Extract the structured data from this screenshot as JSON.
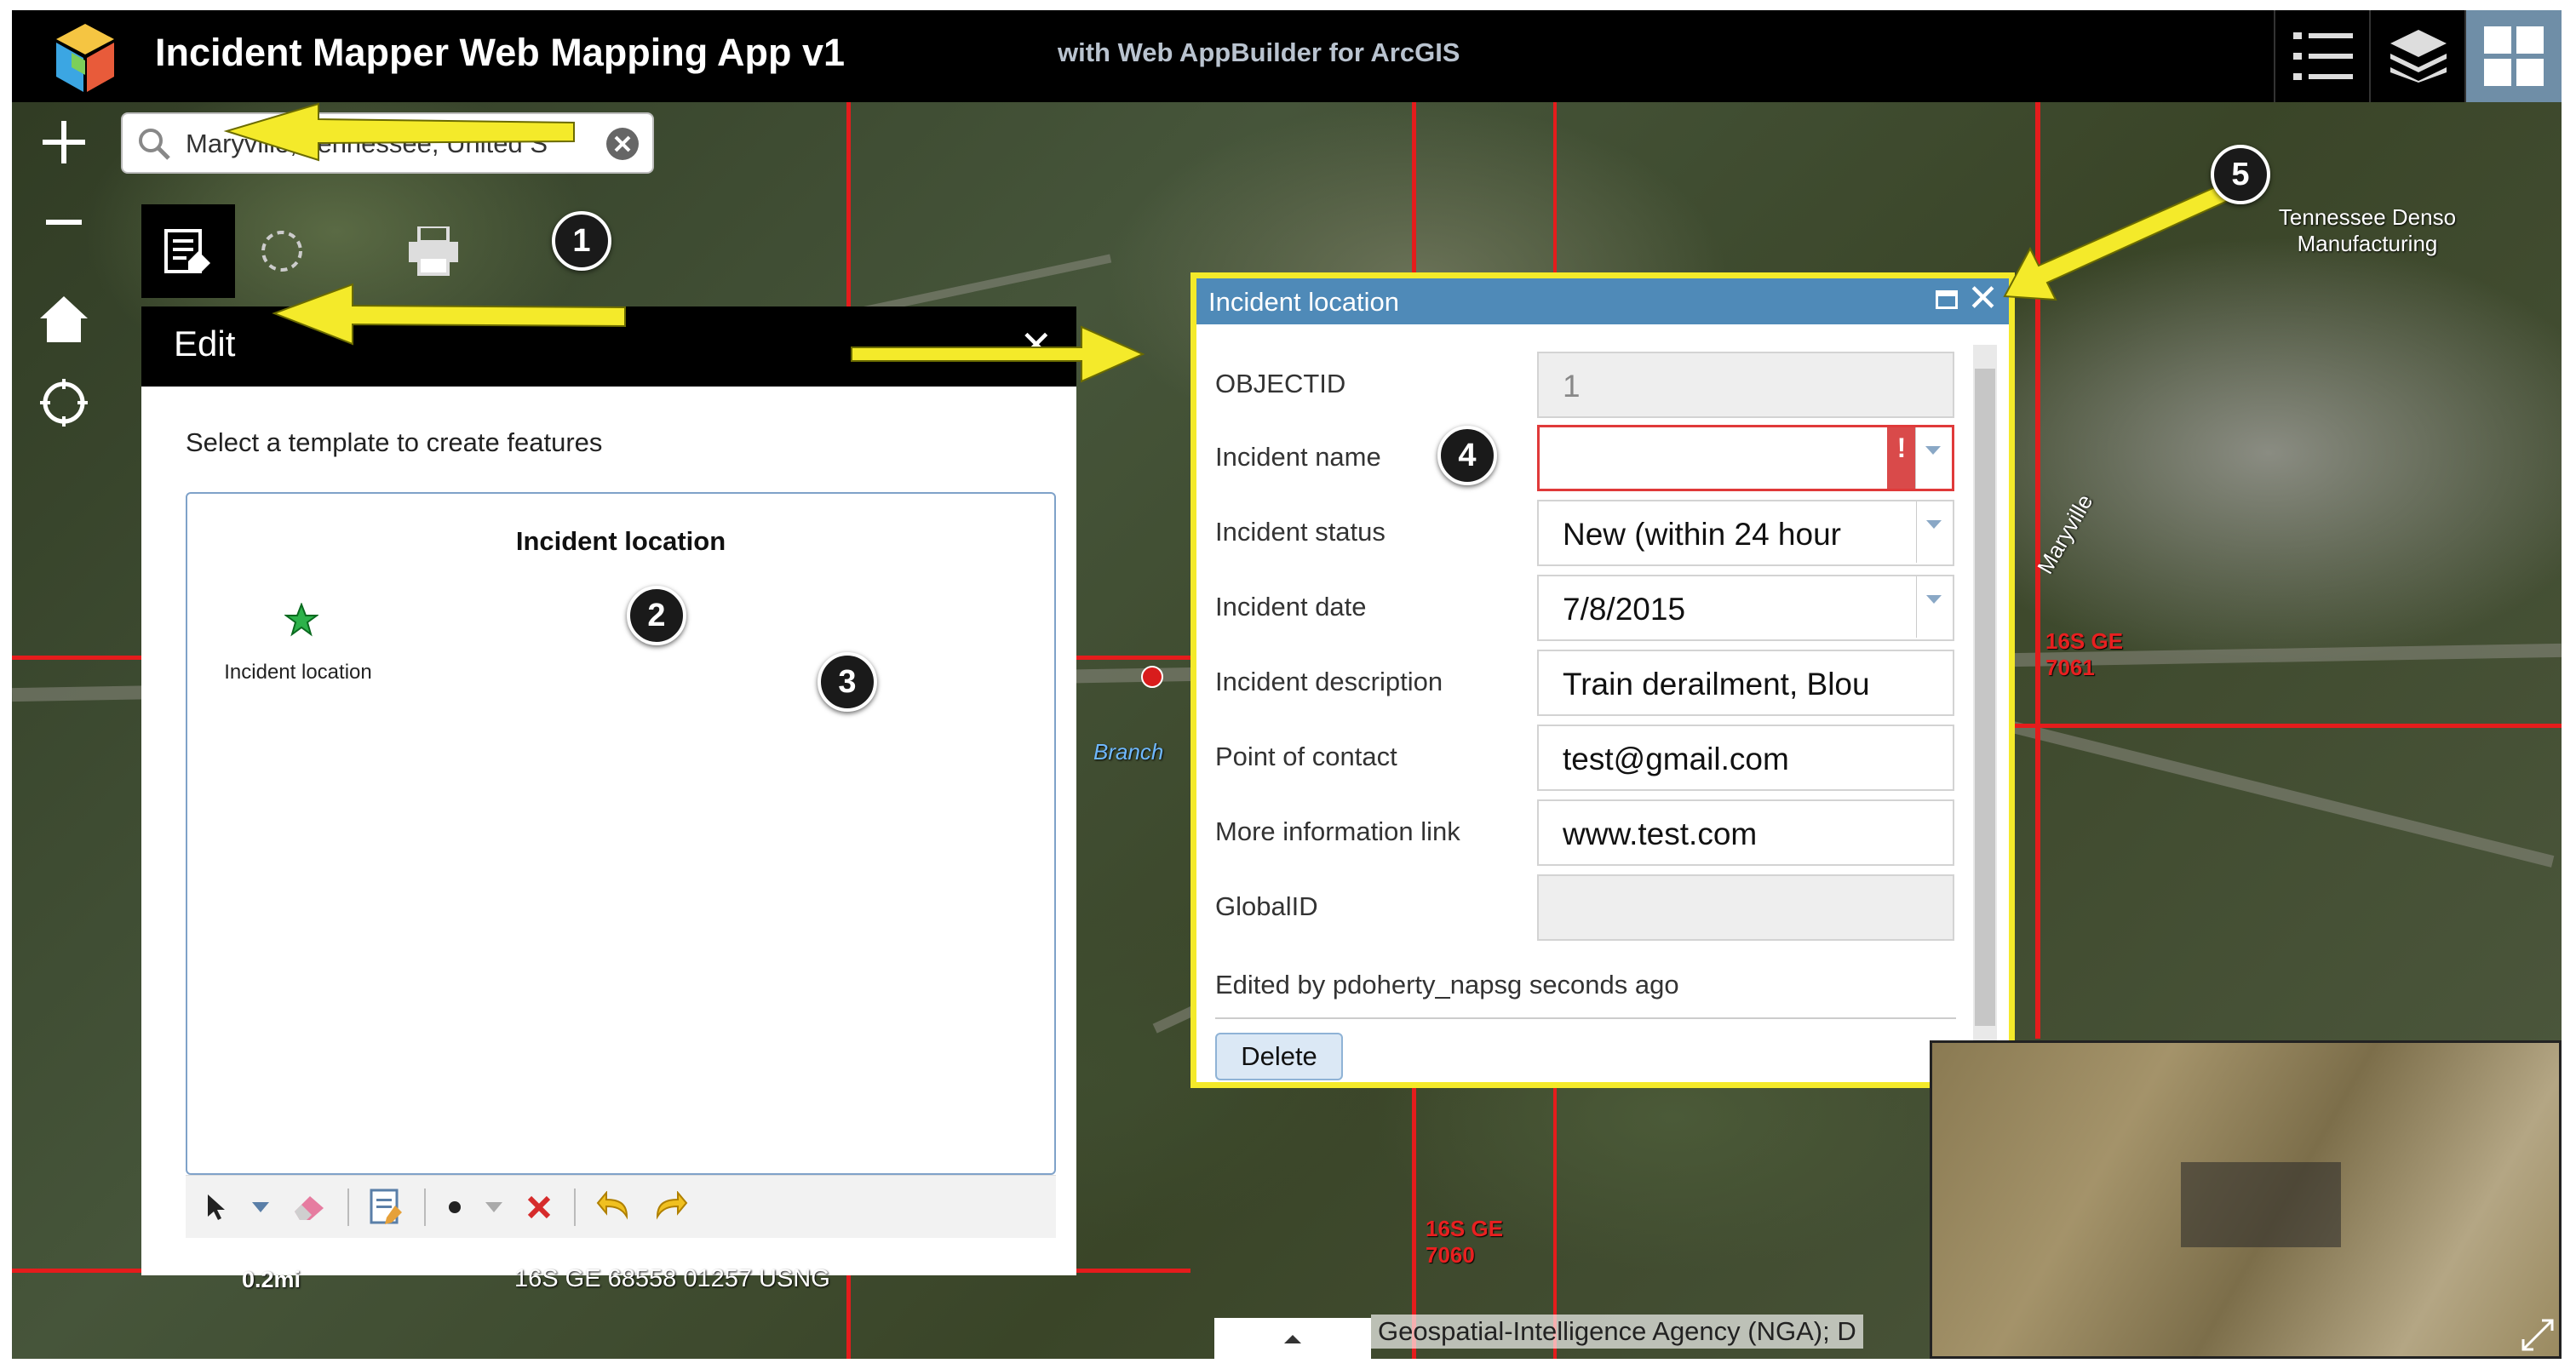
{
  "header": {
    "title": "Incident Mapper Web Mapping App v1",
    "subtitle": "with Web AppBuilder for ArcGIS",
    "icons": [
      "list-icon",
      "layers-icon",
      "grid-icon"
    ]
  },
  "map_controls": [
    "zoom-in-icon",
    "zoom-out-icon",
    "home-icon",
    "locate-icon"
  ],
  "search": {
    "value": "Maryville, Tennessee, United S"
  },
  "widgets": [
    "edit-icon",
    "measure-icon",
    "print-icon"
  ],
  "edit_panel": {
    "title": "Edit",
    "instruction": "Select a template to create features",
    "group_label": "Incident location",
    "template_label": "Incident location"
  },
  "popup": {
    "title": "Incident location",
    "fields": [
      {
        "label": "OBJECTID",
        "value": "1"
      },
      {
        "label": "Incident name",
        "value": ""
      },
      {
        "label": "Incident status",
        "value": "New (within 24 hour"
      },
      {
        "label": "Incident date",
        "value": "7/8/2015"
      },
      {
        "label": "Incident description",
        "value": "Train derailment, Blou"
      },
      {
        "label": "Point of contact",
        "value": "test@gmail.com"
      },
      {
        "label": "More information link",
        "value": "www.test.com"
      },
      {
        "label": "GlobalID",
        "value": ""
      }
    ],
    "edited_by": "Edited by pdoherty_napsg seconds ago",
    "delete_label": "Delete",
    "error_mark": "!"
  },
  "callouts": [
    "1",
    "2",
    "3",
    "4",
    "5"
  ],
  "map_text": {
    "scalebar": "0.2mi",
    "coordinates": "16S GE 68558 01257 USNG",
    "attribution": "Geospatial-Intelligence Agency (NGA); D",
    "place_denso": "Tennessee Denso Manufacturing",
    "place_maryville": "Maryville",
    "place_branch": "Branch",
    "grid_label_1": "16S GE 7061",
    "grid_label_2": "16S GE 7060"
  },
  "colors": {
    "accent": "#4f8ab8",
    "highlight": "#f4ea2a",
    "grid": "#e51c1c",
    "error": "#d94a4a"
  }
}
